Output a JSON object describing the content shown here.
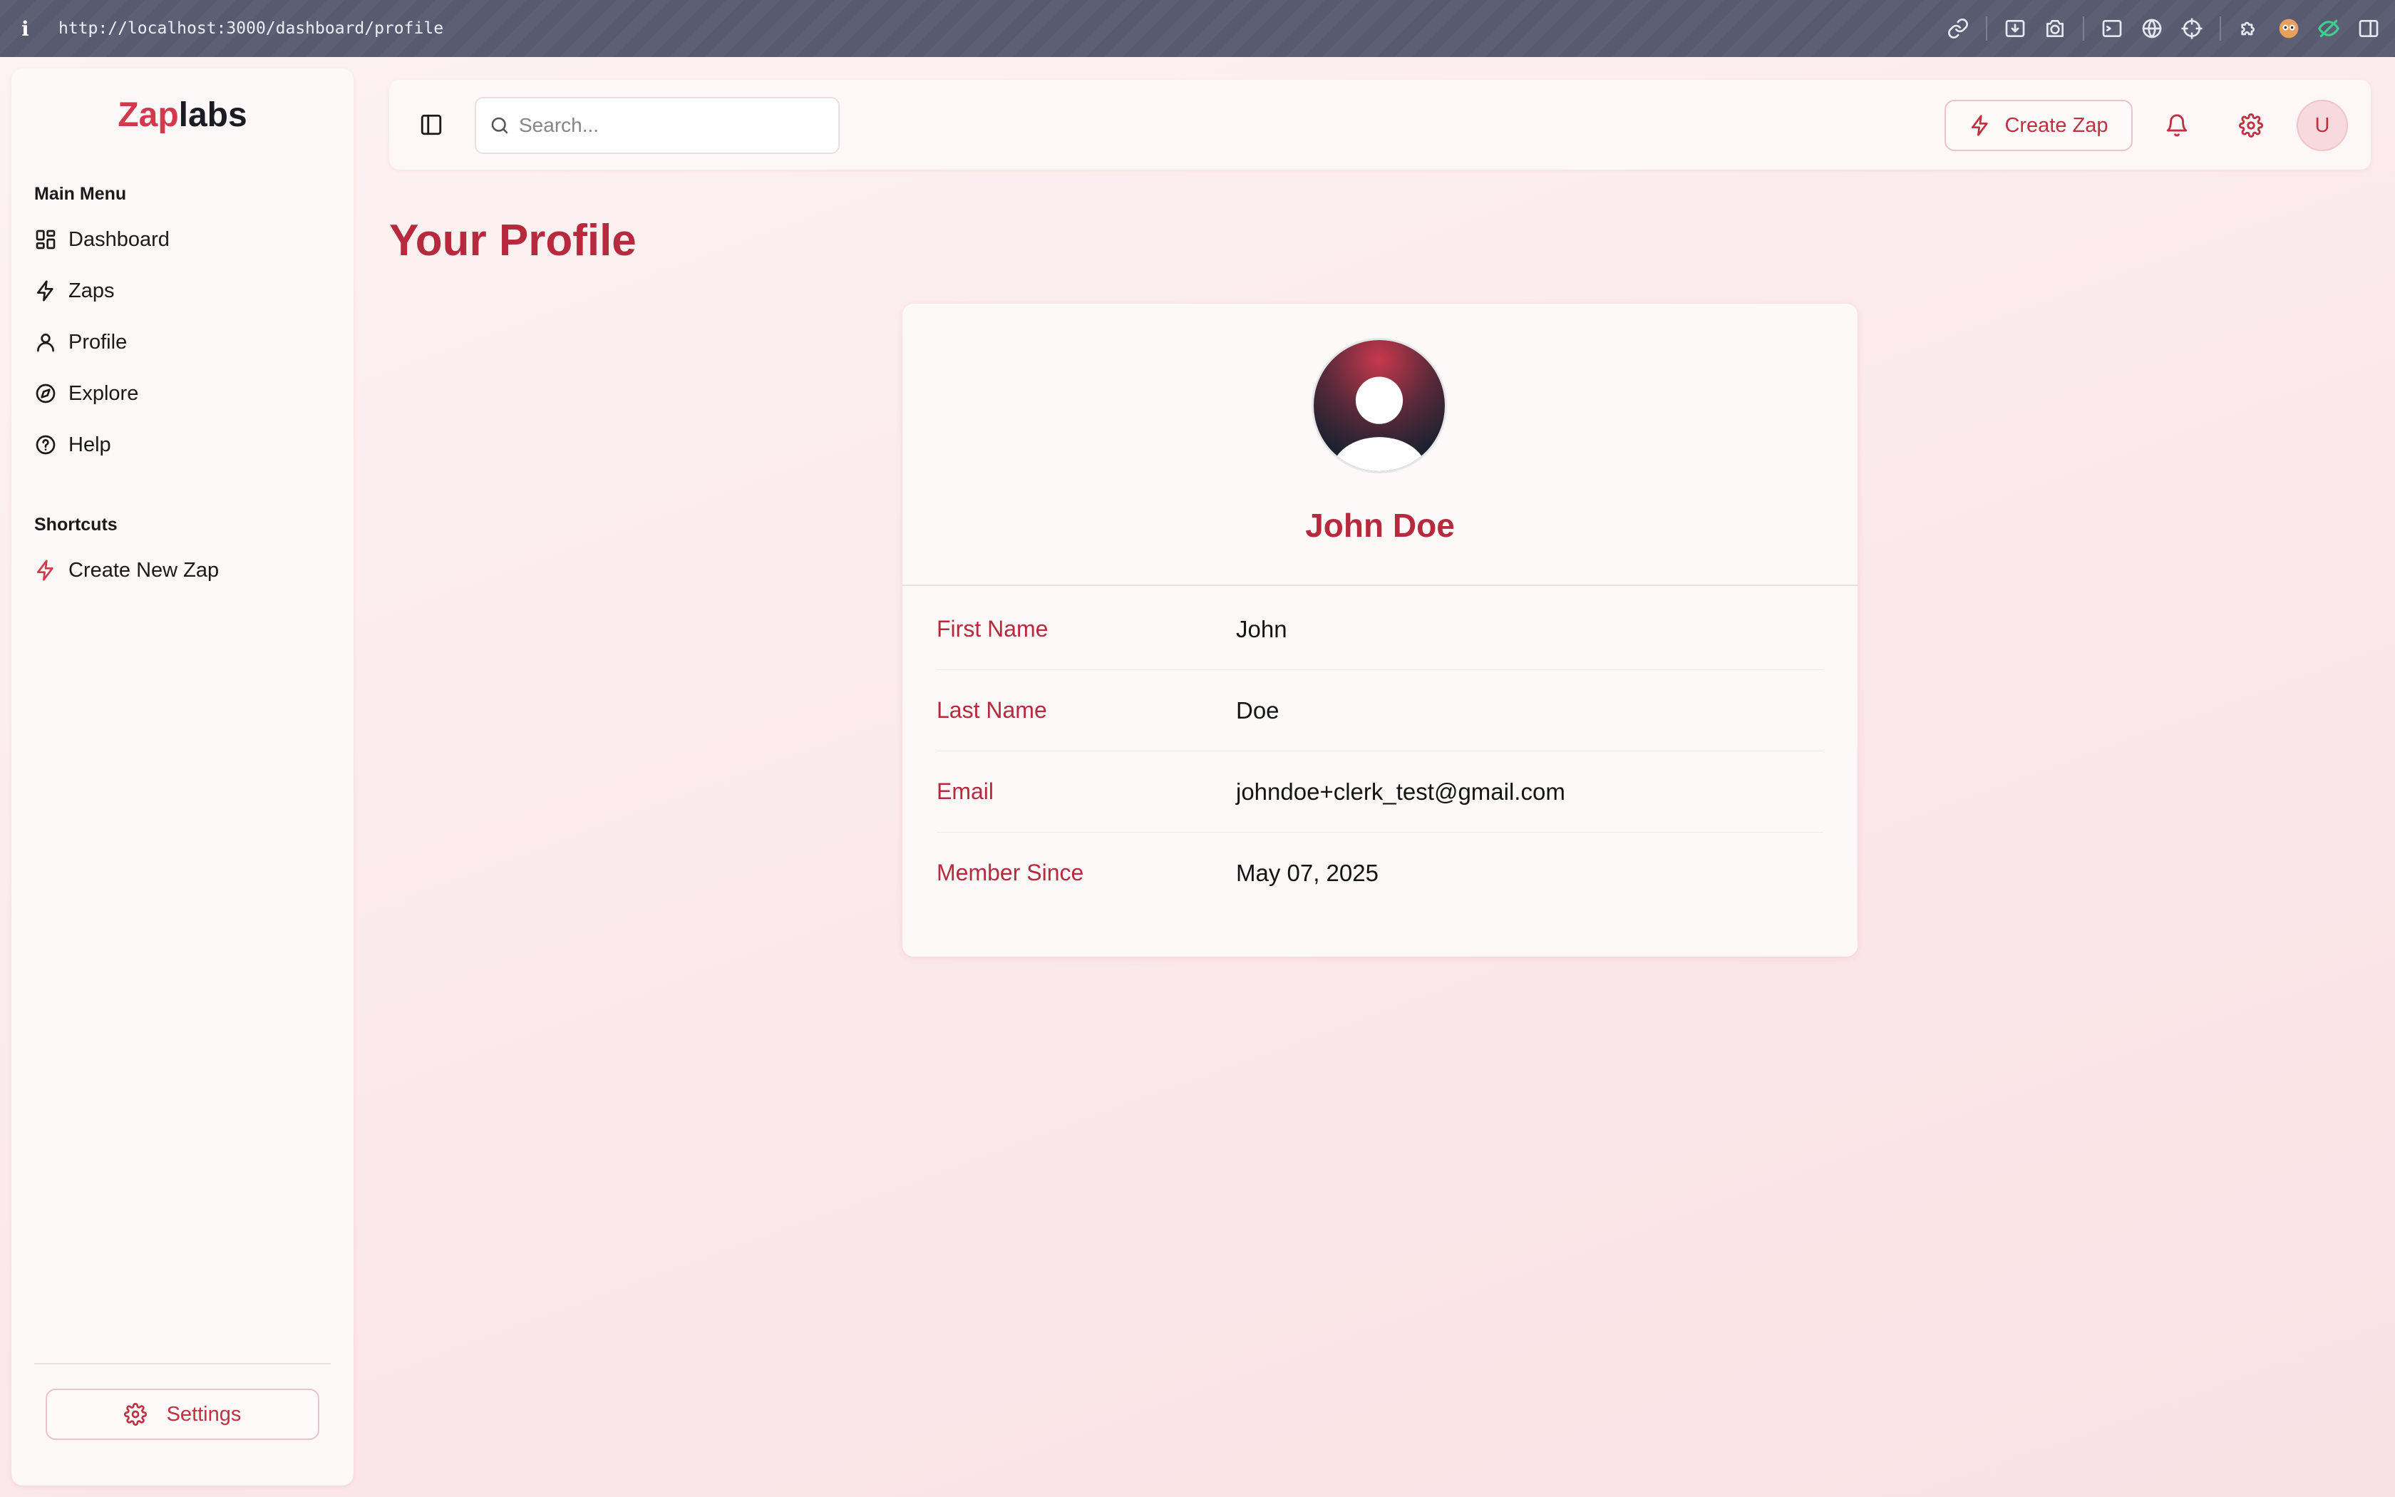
{
  "browser": {
    "info_icon": "i",
    "url": "http://localhost:3000/dashboard/profile",
    "icons": [
      "link-icon",
      "screenshot-save-icon",
      "camera-icon",
      "terminal-icon",
      "globe-icon",
      "crosshair-icon",
      "puzzle-icon",
      "extension-face-icon",
      "extension-eye-icon",
      "split-view-icon"
    ]
  },
  "sidebar": {
    "logo": {
      "part1": "Zap",
      "part2": "labs"
    },
    "main_menu_title": "Main Menu",
    "items": [
      {
        "label": "Dashboard",
        "icon": "dashboard-icon"
      },
      {
        "label": "Zaps",
        "icon": "zap-icon"
      },
      {
        "label": "Profile",
        "icon": "user-icon"
      },
      {
        "label": "Explore",
        "icon": "compass-icon"
      },
      {
        "label": "Help",
        "icon": "help-circle-icon"
      }
    ],
    "shortcuts_title": "Shortcuts",
    "shortcuts": [
      {
        "label": "Create New Zap",
        "icon": "zap-icon"
      }
    ],
    "settings_label": "Settings"
  },
  "header": {
    "search": {
      "placeholder": "Search...",
      "value": ""
    },
    "create_zap_label": "Create Zap",
    "avatar_initial": "U"
  },
  "page": {
    "title": "Your Profile"
  },
  "profile": {
    "name": "John Doe",
    "fields": [
      {
        "label": "First Name",
        "value": "John"
      },
      {
        "label": "Last Name",
        "value": "Doe"
      },
      {
        "label": "Email",
        "value": "johndoe+clerk_test@gmail.com"
      },
      {
        "label": "Member Since",
        "value": "May 07, 2025"
      }
    ]
  },
  "colors": {
    "brand": "#d13a4d",
    "accent": "#b72a3d",
    "background": "#fbe8ea"
  }
}
